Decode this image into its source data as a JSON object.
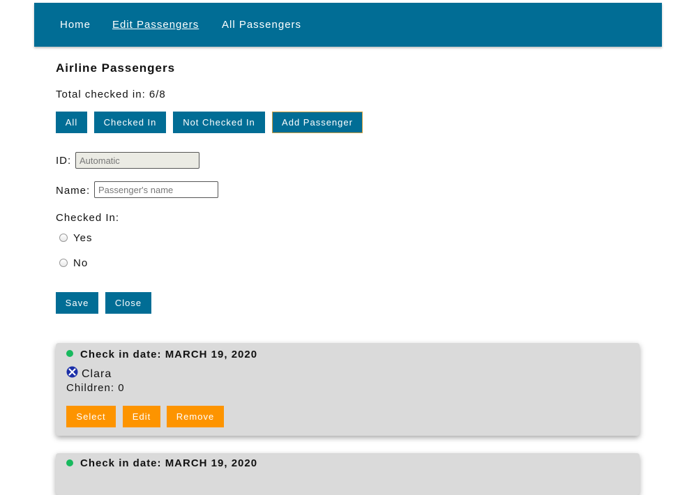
{
  "nav": {
    "home": "Home",
    "edit_passengers": "Edit Passengers",
    "all_passengers": "All Passengers"
  },
  "page": {
    "title": "Airline Passengers",
    "total_label": "Total checked in:",
    "total_value": "6/8"
  },
  "filters": {
    "all": "All",
    "checked_in": "Checked In",
    "not_checked_in": "Not Checked In",
    "add_passenger": "Add Passenger"
  },
  "form": {
    "id_label": "ID:",
    "id_value": "Automatic",
    "name_label": "Name:",
    "name_placeholder": "Passenger's name",
    "checked_in_label": "Checked In:",
    "yes": "Yes",
    "no": "No",
    "save": "Save",
    "close": "Close"
  },
  "cards": [
    {
      "date_label": "Check in date: MARCH 19, 2020",
      "name": "Clara",
      "children": "Children: 0",
      "select": "Select",
      "edit": "Edit",
      "remove": "Remove"
    },
    {
      "date_label": "Check in date: MARCH 19, 2020"
    }
  ],
  "colors": {
    "primary": "#016d95",
    "action": "#fd9400",
    "status_dot": "#18b95e",
    "card_bg": "#dadada",
    "icon_blue": "#1b2fa8"
  },
  "icons": {
    "passenger_status": "x-box-icon",
    "checked_status": "status-dot-icon"
  }
}
